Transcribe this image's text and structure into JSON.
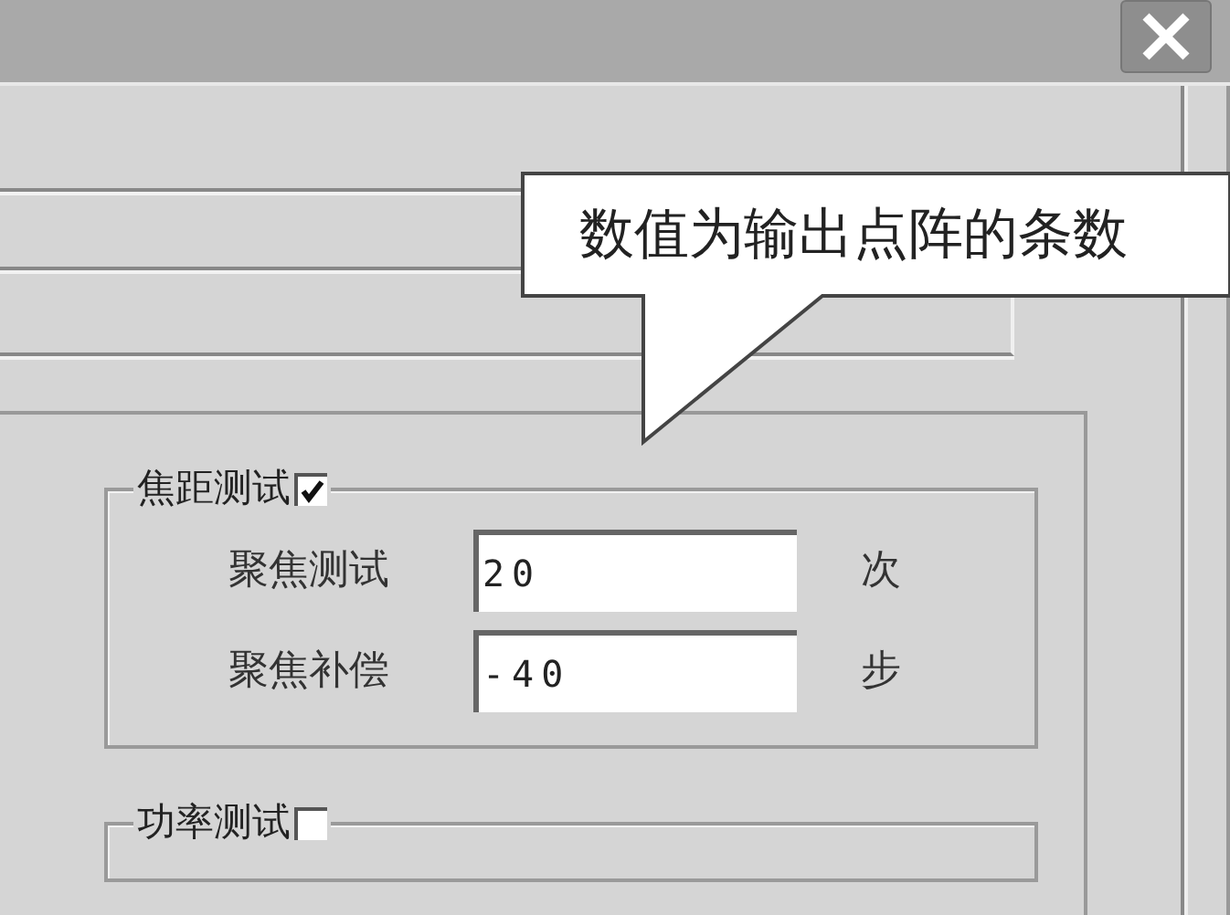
{
  "callout": {
    "text": "数值为输出点阵的条数"
  },
  "groups": [
    {
      "title": "焦距测试",
      "checked": true,
      "fields": [
        {
          "label": "聚焦测试",
          "value": "20",
          "unit": "次"
        },
        {
          "label": "聚焦补偿",
          "value": "-40",
          "unit": "步"
        }
      ]
    },
    {
      "title": "功率测试",
      "checked": false
    }
  ]
}
